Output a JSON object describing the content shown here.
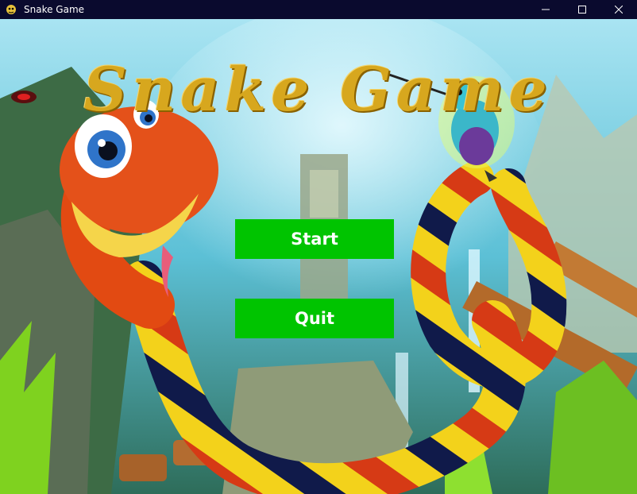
{
  "window": {
    "title": "Snake Game",
    "icon": "snake-app-icon",
    "controls": {
      "minimize": "minimize-icon",
      "maximize": "maximize-icon",
      "close": "close-icon"
    }
  },
  "game": {
    "title": "Snake Game",
    "title_color": "#d7a71e",
    "menu": {
      "start_label": "Start",
      "quit_label": "Quit",
      "button_color": "#00c400"
    }
  }
}
